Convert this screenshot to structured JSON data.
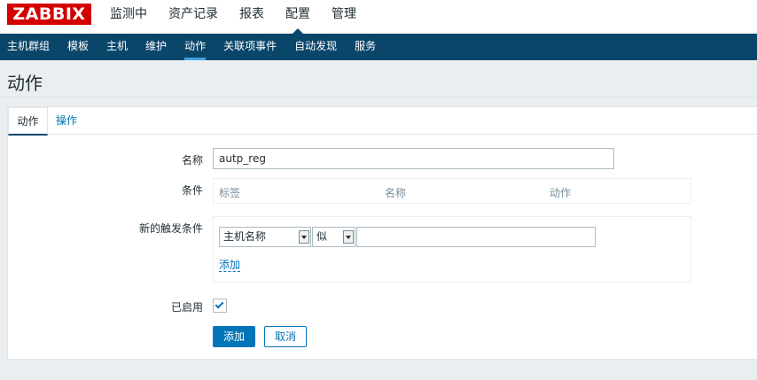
{
  "header": {
    "logo": "ZABBIX",
    "menu": [
      {
        "label": "监测中"
      },
      {
        "label": "资产记录"
      },
      {
        "label": "报表"
      },
      {
        "label": "配置",
        "active": true
      },
      {
        "label": "管理"
      }
    ]
  },
  "subnav": {
    "items": [
      {
        "label": "主机群组"
      },
      {
        "label": "模板"
      },
      {
        "label": "主机"
      },
      {
        "label": "维护"
      },
      {
        "label": "动作",
        "active": true
      },
      {
        "label": "关联项事件"
      },
      {
        "label": "自动发现"
      },
      {
        "label": "服务"
      }
    ]
  },
  "page": {
    "title": "动作"
  },
  "tabs": {
    "action": "动作",
    "operations": "操作"
  },
  "form": {
    "name_label": "名称",
    "name_value": "autp_reg",
    "conditions_label": "条件",
    "conditions_headers": [
      "标签",
      "名称",
      "动作"
    ],
    "new_condition_label": "新的触发条件",
    "condition_type": "主机名称",
    "condition_operator": "似",
    "condition_value": "",
    "add_link": "添加",
    "enabled_label": "已启用",
    "enabled": true,
    "add_button": "添加",
    "cancel_button": "取消"
  },
  "colors": {
    "brand": "#d40000",
    "nav_bg": "#0a466a",
    "link": "#0275b8"
  }
}
